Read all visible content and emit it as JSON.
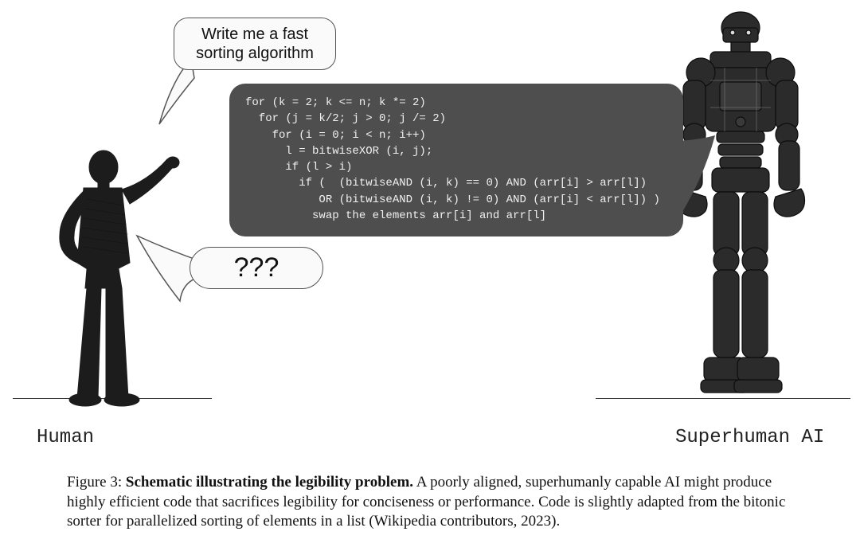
{
  "human_label": "Human",
  "robot_label": "Superhuman AI",
  "prompt_bubble": "Write me a fast\nsorting algorithm",
  "question_bubble": "???",
  "code_lines": [
    "for (k = 2; k <= n; k *= 2)",
    "  for (j = k/2; j > 0; j /= 2)",
    "    for (i = 0; i < n; i++)",
    "      l = bitwiseXOR (i, j);",
    "      if (l > i)",
    "        if (  (bitwiseAND (i, k) == 0) AND (arr[i] > arr[l])",
    "           OR (bitwiseAND (i, k) != 0) AND (arr[i] < arr[l]) )",
    "          swap the elements arr[i] and arr[l]"
  ],
  "caption": {
    "figure_label": "Figure 3: ",
    "bold_title": "Schematic illustrating the legibility problem.",
    "body": " A poorly aligned, superhumanly capable AI might produce highly efficient code that sacrifices legibility for conciseness or performance. Code is slightly adapted from the bitonic sorter for parallelized sorting of elements in a list (Wikipedia contributors, 2023)."
  }
}
